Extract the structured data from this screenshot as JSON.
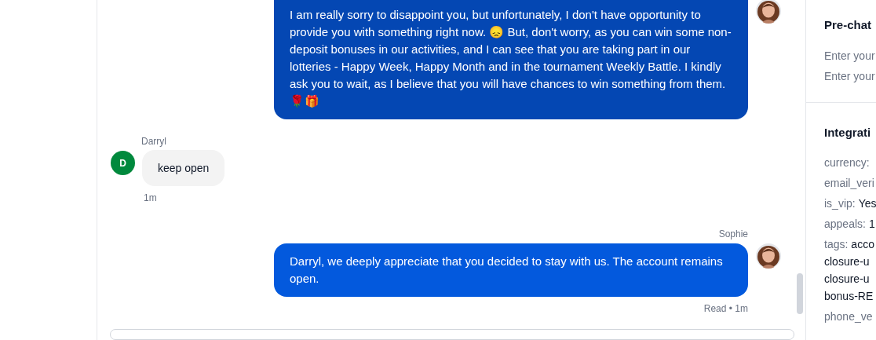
{
  "messages": [
    {
      "kind": "agent",
      "text": "I am really sorry to disappoint you, but unfortunately, I don't have opportunity to provide you with something right now. 😞 But, don't worry, as you can win some non-deposit bonuses in our activities, and I can see that you are taking part in our lotteries - Happy Week, Happy Month and in the tournament Weekly Battle. I kindly ask you to wait, as I believe that you will have chances to win something from them. 🌹🎁"
    },
    {
      "kind": "customer",
      "author": "Darryl",
      "initial": "D",
      "text": "keep open",
      "meta": "1m"
    },
    {
      "kind": "agent",
      "author": "Sophie",
      "text": "Darryl, we deeply appreciate that you decided to stay with us. The account remains open.",
      "meta": "Read • 1m"
    }
  ],
  "side_panel": {
    "sections": [
      {
        "title": "Pre-chat",
        "rows": [
          {
            "label": "Enter your"
          },
          {
            "label": "Enter your"
          }
        ]
      },
      {
        "title": "Integrati",
        "rows": [
          {
            "label": "currency:"
          },
          {
            "label": "email_veri"
          },
          {
            "label": "is_vip:",
            "value": "Yes"
          },
          {
            "label": "appeals:",
            "value": "1"
          },
          {
            "label": "tags:",
            "value": "acco",
            "more": [
              "closure-u",
              "closure-u",
              "bonus-RE"
            ]
          },
          {
            "label": "phone_ve"
          }
        ]
      }
    ]
  }
}
